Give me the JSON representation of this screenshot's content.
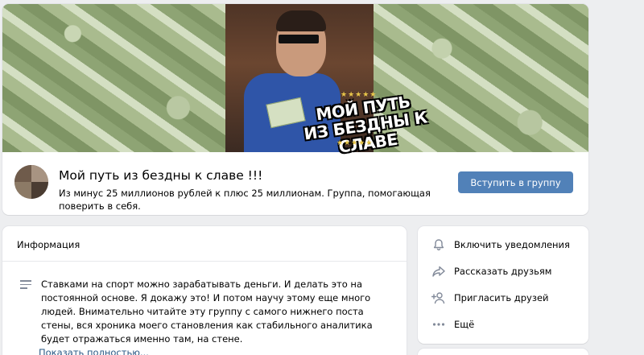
{
  "cover": {
    "title_line1": "Мой путь",
    "title_line2": "из бездны к славе",
    "stars": "★★★★★"
  },
  "group": {
    "name": "Мой путь из бездны к славе !!!",
    "status": "Из минус 25 миллионов рублей к плюс 25 миллионам. Группа, помогающая поверить в себя.",
    "join_label": "Вступить в группу"
  },
  "info": {
    "title": "Информация",
    "description": "Ставками на спорт можно зарабатывать деньги. И делать это на постоянной основе. Я докажу это! И потом научу этому еще много людей. Внимательно читайте эту группу с самого нижнего поста стены, вся хроника моего становления как стабильного аналитика будет отражаться именно там, на стене.",
    "show_more": "Показать полностью..."
  },
  "actions": [
    {
      "icon": "bell-icon",
      "label": "Включить уведомления"
    },
    {
      "icon": "share-icon",
      "label": "Рассказать друзьям"
    },
    {
      "icon": "add-user-icon",
      "label": "Пригласить друзей"
    },
    {
      "icon": "more-icon",
      "label": "Ещё"
    }
  ],
  "colors": {
    "accent": "#5181b8",
    "link": "#2a5885",
    "background": "#edeef0",
    "icon": "#828a99"
  }
}
